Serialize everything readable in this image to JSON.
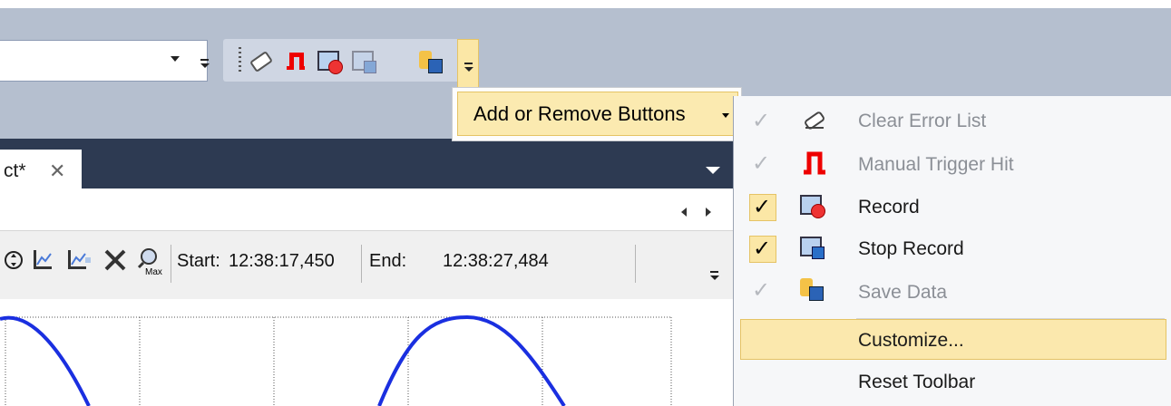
{
  "toolbar": {
    "combo_value": "",
    "overflow_label": "Add or Remove Buttons"
  },
  "menu": {
    "items": [
      {
        "label": "Clear Error List",
        "checked": false,
        "enabled": false,
        "icon": "eraser-icon"
      },
      {
        "label": "Manual Trigger Hit",
        "checked": false,
        "enabled": false,
        "icon": "trigger-icon"
      },
      {
        "label": "Record",
        "checked": true,
        "enabled": true,
        "icon": "record-icon"
      },
      {
        "label": "Stop Record",
        "checked": true,
        "enabled": true,
        "icon": "stop-record-icon"
      },
      {
        "label": "Save Data",
        "checked": false,
        "enabled": false,
        "icon": "save-data-icon"
      }
    ],
    "customize_label": "Customize...",
    "reset_label": "Reset Toolbar"
  },
  "document": {
    "tab_label": "ct*",
    "close_glyph": "✕"
  },
  "chart_toolbar": {
    "start_label": "Start:",
    "start_value": "12:38:17,450",
    "end_label": "End:",
    "end_value": "12:38:27,484",
    "nav_left": "◁",
    "nav_right": "▷"
  },
  "colors": {
    "toolbar_bg": "#b5bfcf",
    "dark_band": "#2d3a52",
    "highlight": "#fbe8ad",
    "curve": "#1a2fe0"
  }
}
